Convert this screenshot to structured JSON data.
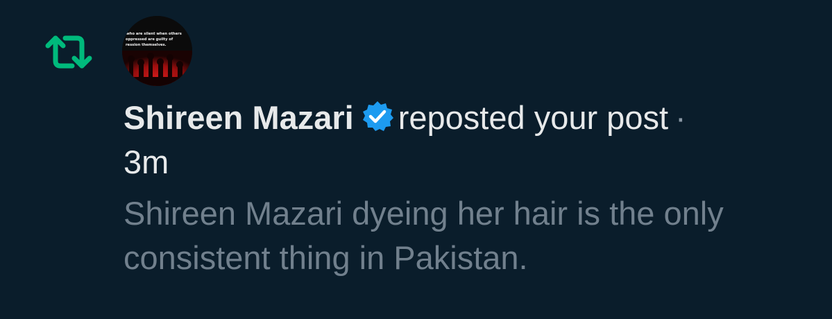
{
  "notification": {
    "type_icon": "repost-icon",
    "accent_color": "#00ba7c",
    "verified_color": "#1d9bf0",
    "avatar": {
      "icon": "avatar-image",
      "text_lines": [
        "who are silent when others",
        "oppressed are guilty of",
        "ression themselves."
      ]
    },
    "user_name": "Shireen Mazari",
    "verified_icon": "verified-badge-icon",
    "action": "reposted your post",
    "separator": "·",
    "time": "3m",
    "post_text": "Shireen Mazari dyeing her hair is the only consistent thing in Pakistan."
  }
}
